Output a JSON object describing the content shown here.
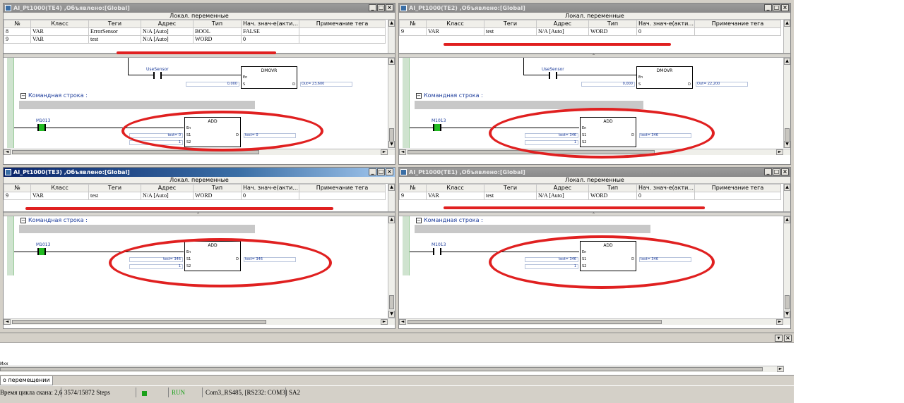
{
  "windows": {
    "te4": {
      "title": "AI_Pt1000(TE4) ,Объявлено:[Global]",
      "rows": [
        {
          "no": "8",
          "cls": "VAR",
          "tag": "ErrorSensor",
          "addr": "N/A [Auto]",
          "type": "BOOL",
          "init": "FALSE",
          "note": ""
        },
        {
          "no": "9",
          "cls": "VAR",
          "tag": "test",
          "addr": "N/A [Auto]",
          "type": "WORD",
          "init": "0",
          "note": ""
        }
      ],
      "dmovr": {
        "contact": "UseSensor",
        "name": "DMOVR",
        "in_en": "En",
        "in_s": "S",
        "out_d": "D",
        "s_val": "0,000",
        "out_val": "Out= 23,600"
      },
      "add": {
        "contact": "M1013",
        "name": "ADD",
        "en": "En",
        "s1": "S1",
        "s2": "S2",
        "d": "D",
        "s1_val": "test= 0",
        "s2_val": "1",
        "d_val": "test= 0"
      }
    },
    "te2": {
      "title": "AI_Pt1000(TE2) ,Объявлено:[Global]",
      "rows": [
        {
          "no": "9",
          "cls": "VAR",
          "tag": "test",
          "addr": "N/A [Auto]",
          "type": "WORD",
          "init": "0",
          "note": ""
        }
      ],
      "dmovr": {
        "contact": "UseSensor",
        "name": "DMOVR",
        "in_en": "En",
        "in_s": "S",
        "out_d": "D",
        "s_val": "0,000",
        "out_val": "Out= 22,200"
      },
      "add": {
        "contact": "M1013",
        "name": "ADD",
        "en": "En",
        "s1": "S1",
        "s2": "S2",
        "d": "D",
        "s1_val": "test= 346",
        "s2_val": "1",
        "d_val": "test= 346"
      }
    },
    "te3": {
      "title": "AI_Pt1000(TE3) ,Объявлено:[Global]",
      "rows": [
        {
          "no": "9",
          "cls": "VAR",
          "tag": "test",
          "addr": "N/A [Auto]",
          "type": "WORD",
          "init": "0",
          "note": ""
        }
      ],
      "add": {
        "contact": "M1013",
        "name": "ADD",
        "en": "En",
        "s1": "S1",
        "s2": "S2",
        "d": "D",
        "s1_val": "test= 346",
        "s2_val": "1",
        "d_val": "test= 346"
      }
    },
    "te1": {
      "title": "AI_Pt1000(TE1) ,Объявлено:[Global]",
      "rows": [
        {
          "no": "9",
          "cls": "VAR",
          "tag": "test",
          "addr": "N/A [Auto]",
          "type": "WORD",
          "init": "0",
          "note": ""
        }
      ],
      "add": {
        "contact": "M1013",
        "name": "ADD",
        "en": "En",
        "s1": "S1",
        "s2": "S2",
        "d": "D",
        "s1_val": "test= 346",
        "s2_val": "1",
        "d_val": "test= 346"
      }
    }
  },
  "grid": {
    "caption": "Локал. переменные",
    "headers": {
      "no": "№",
      "cls": "Класс",
      "tag": "Теги",
      "addr": "Адрес",
      "type": "Тип",
      "init": "Нач. знач-е(акти...",
      "note": "Примечание тега"
    }
  },
  "cmd_label": "Командная строка :",
  "bottom": {
    "text": "Ихх",
    "tab": "о перемещении"
  },
  "status": {
    "cycle": "Время цикла скана: 2,6",
    "steps": "3574/15872 Steps",
    "run": "RUN",
    "port": "Com3_RS485, [RS232: COM3]",
    "station": "SA2"
  },
  "colors": {
    "annotation": "#e02020",
    "run_led": "#1aa01a",
    "contact_on": "#22bb22"
  }
}
